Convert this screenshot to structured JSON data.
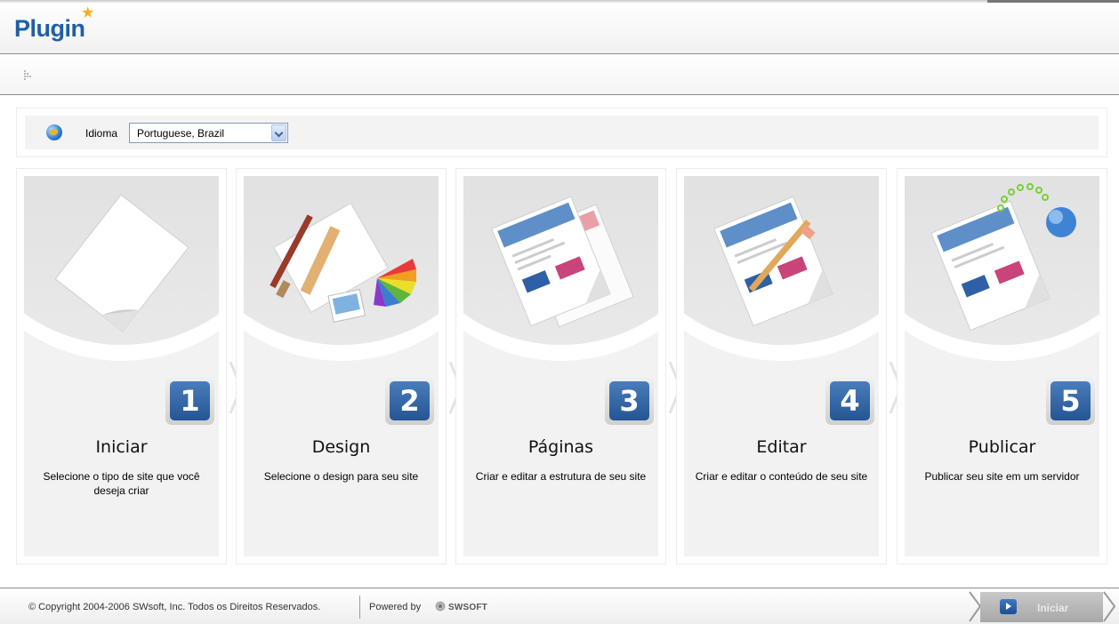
{
  "header": {
    "logo_main": "Plug",
    "logo_tail": "in"
  },
  "language": {
    "label": "Idioma",
    "selected": "Portuguese, Brazil"
  },
  "steps": [
    {
      "number": "1",
      "title": "Iniciar",
      "description": "Selecione o tipo de site que você deseja criar",
      "icon": "blank-page-icon"
    },
    {
      "number": "2",
      "title": "Design",
      "description": "Selecione o design para seu site",
      "icon": "design-tools-icon"
    },
    {
      "number": "3",
      "title": "Páginas",
      "description": "Criar e editar a estrutura de seu site",
      "icon": "pages-icon"
    },
    {
      "number": "4",
      "title": "Editar",
      "description": "Criar e editar o conteúdo de seu site",
      "icon": "edit-page-icon"
    },
    {
      "number": "5",
      "title": "Publicar",
      "description": "Publicar seu site em um servidor",
      "icon": "publish-globe-icon"
    }
  ],
  "footer": {
    "copyright": "© Copyright 2004-2006 SWsoft, Inc. Todos os Direitos Reservados.",
    "powered_by": "Powered by",
    "brand": "SWSOFT",
    "start_button": "Iniciar"
  },
  "colors": {
    "brand_blue": "#1f5fa7",
    "step_number_blue": "#245594",
    "card_background": "#f2f2f2"
  }
}
